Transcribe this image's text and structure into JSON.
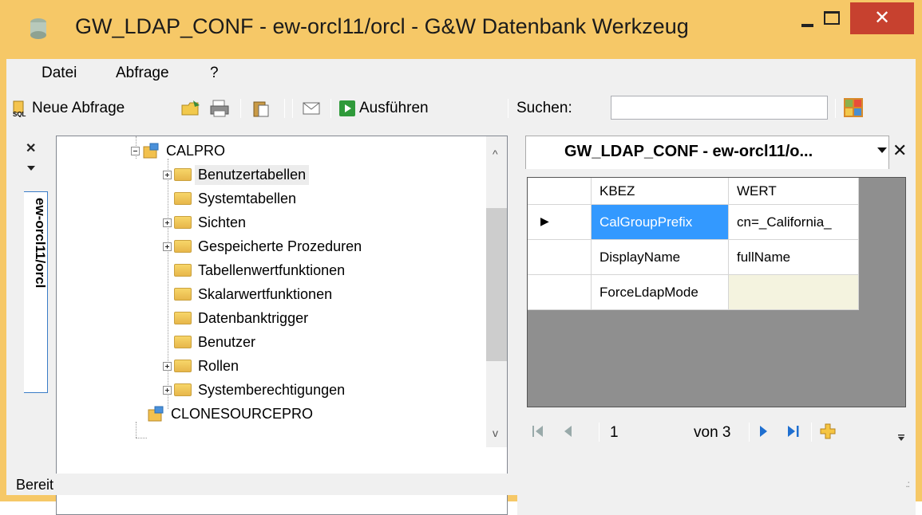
{
  "window": {
    "title": "GW_LDAP_CONF - ew-orcl11/orcl - G&W Datenbank Werkzeug",
    "close_glyph": "✕"
  },
  "menu": {
    "items": [
      "Datei",
      "Abfrage",
      "?"
    ]
  },
  "toolbar": {
    "new_query": "Neue Abfrage",
    "execute": "Ausführen",
    "search_label": "Suchen:",
    "search_value": ""
  },
  "sidebar": {
    "close_glyph": "✕",
    "tab_label": "ew-orcl11/orcl"
  },
  "tree": {
    "root": "CALPRO",
    "children": [
      "Benutzertabellen",
      "Systemtabellen",
      "Sichten",
      "Gespeicherte Prozeduren",
      "Tabellenwertfunktionen",
      "Skalarwertfunktionen",
      "Datenbanktrigger",
      "Benutzer",
      "Rollen",
      "Systemberechtigungen"
    ],
    "next_root": "CLONESOURCEPRO"
  },
  "document": {
    "tab_label": "GW_LDAP_CONF - ew-orcl11/o...",
    "close_glyph": "✕",
    "columns": [
      "KBEZ",
      "WERT"
    ],
    "rows": [
      [
        "CalGroupPrefix",
        "cn=_California_"
      ],
      [
        "DisplayName",
        "fullName"
      ],
      [
        "ForceLdapMode",
        ""
      ]
    ],
    "row_indicator": "▶",
    "navigator": {
      "position": "1",
      "of_label": "von 3"
    }
  },
  "status": {
    "text": "Bereit"
  },
  "colors": {
    "title_bar": "#f6c867",
    "close_button": "#c7412f",
    "selected_cell": "#3399ff",
    "empty_cell": "#f4f3df"
  }
}
